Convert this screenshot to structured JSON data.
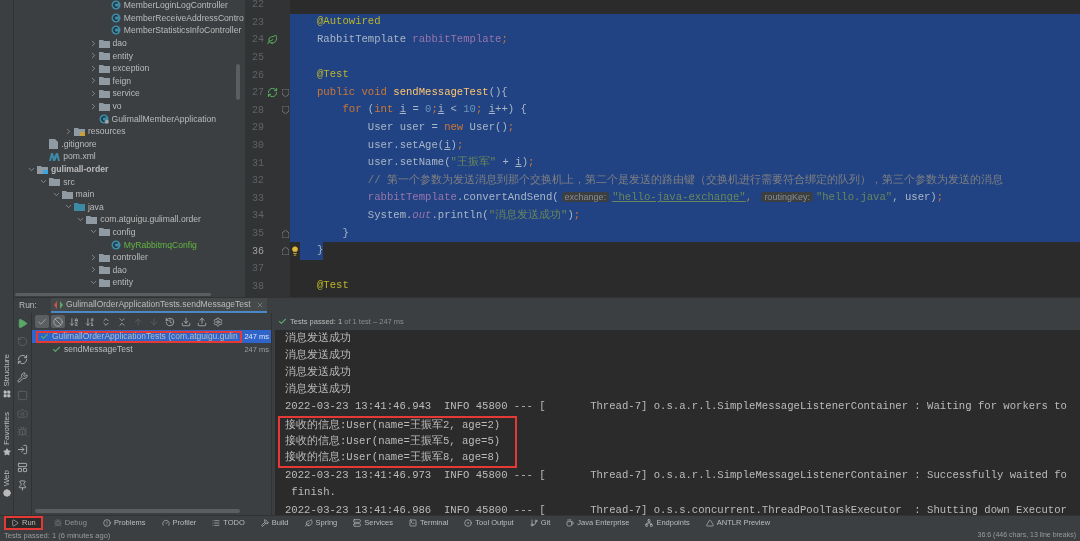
{
  "project_tree": [
    {
      "children": [
        {
          "children": [
            {
              "children": [
                {
                  "children": [
                    {
                      "children": [
                        {
                          "children": [
                            {
                              "label": "MemberLoginLogController",
                              "kind": "class"
                            },
                            {
                              "label": "MemberReceiveAddressContro",
                              "kind": "class"
                            },
                            {
                              "label": "MemberStatisticsInfoController",
                              "kind": "class"
                            }
                          ]
                        },
                        {
                          "label": "dao",
                          "kind": "folder",
                          "expanded": false
                        },
                        {
                          "label": "entity",
                          "kind": "folder",
                          "expanded": false
                        },
                        {
                          "label": "exception",
                          "kind": "folder",
                          "expanded": false
                        },
                        {
                          "label": "feign",
                          "kind": "folder",
                          "expanded": false
                        },
                        {
                          "label": "service",
                          "kind": "folder",
                          "expanded": false
                        },
                        {
                          "label": "vo",
                          "kind": "folder",
                          "expanded": false
                        },
                        {
                          "label": "GulimallMemberApplication",
                          "kind": "app"
                        }
                      ]
                    }
                  ]
                },
                {
                  "label": "resources",
                  "kind": "resources",
                  "expanded": false
                }
              ]
            }
          ]
        },
        {
          "label": ".gitignore",
          "kind": "file"
        },
        {
          "label": "pom.xml",
          "kind": "maven"
        }
      ]
    },
    {
      "label": "gulimall-order",
      "kind": "module",
      "expanded": true,
      "children": [
        {
          "label": "src",
          "kind": "folder",
          "expanded": true,
          "children": [
            {
              "label": "main",
              "kind": "folder",
              "expanded": true,
              "children": [
                {
                  "label": "java",
                  "kind": "source",
                  "expanded": true,
                  "children": [
                    {
                      "label": "com.atguigu.gulimall.order",
                      "kind": "folder",
                      "expanded": true,
                      "children": [
                        {
                          "label": "config",
                          "kind": "folder",
                          "expanded": true,
                          "children": [
                            {
                              "label": "MyRabbitmqConfig",
                              "kind": "new-class"
                            }
                          ]
                        },
                        {
                          "label": "controller",
                          "kind": "folder",
                          "expanded": false
                        },
                        {
                          "label": "dao",
                          "kind": "folder",
                          "expanded": false
                        },
                        {
                          "label": "entity",
                          "kind": "folder",
                          "expanded": true
                        }
                      ]
                    }
                  ]
                }
              ]
            }
          ]
        }
      ]
    }
  ],
  "editor": {
    "lines": [
      {
        "number": "22",
        "selected": false,
        "current": false
      },
      {
        "number": "23",
        "selected": true,
        "current": false,
        "tokens": [
          {
            "text": "@Autowired",
            "kind": "annotation"
          }
        ]
      },
      {
        "number": "24",
        "selected": true,
        "current": false,
        "icons": [
          {
            "kind": "bean"
          }
        ],
        "tokens": [
          {
            "text": "RabbitTemplate ",
            "kind": "plain"
          },
          {
            "text": "rabbitTemplate",
            "kind": "field"
          },
          {
            "text": ";",
            "kind": "keyword"
          }
        ]
      },
      {
        "number": "25",
        "selected": true,
        "current": false
      },
      {
        "number": "26",
        "selected": true,
        "current": false,
        "tokens": [
          {
            "text": "@Test",
            "kind": "annotation"
          }
        ]
      },
      {
        "number": "27",
        "selected": true,
        "current": false,
        "icons": [
          {
            "kind": "run"
          },
          {
            "kind": "fold-start"
          }
        ],
        "tokens": [
          {
            "text": "public void ",
            "kind": "keyword"
          },
          {
            "text": "sendMessageTest",
            "kind": "method"
          },
          {
            "text": "(){",
            "kind": "plain"
          }
        ]
      },
      {
        "number": "28",
        "selected": true,
        "current": false,
        "icons": [
          {
            "kind": "fold-start"
          }
        ],
        "tokens": [
          {
            "text": "    for",
            "kind": "keyword"
          },
          {
            "text": " (",
            "kind": "plain"
          },
          {
            "text": "int ",
            "kind": "keyword"
          },
          {
            "text": "i",
            "kind": "var"
          },
          {
            "text": " = ",
            "kind": "plain"
          },
          {
            "text": "0",
            "kind": "number"
          },
          {
            "text": ";",
            "kind": "keyword"
          },
          {
            "text": "i",
            "kind": "var"
          },
          {
            "text": " < ",
            "kind": "plain"
          },
          {
            "text": "10",
            "kind": "number"
          },
          {
            "text": "; ",
            "kind": "keyword"
          },
          {
            "text": "i",
            "kind": "var"
          },
          {
            "text": "++) {",
            "kind": "plain"
          }
        ]
      },
      {
        "number": "29",
        "selected": true,
        "current": false,
        "tokens": [
          {
            "text": "        User user = ",
            "kind": "plain"
          },
          {
            "text": "new",
            "kind": "keyword"
          },
          {
            "text": " User()",
            "kind": "plain"
          },
          {
            "text": ";",
            "kind": "keyword"
          }
        ]
      },
      {
        "number": "30",
        "selected": true,
        "current": false,
        "tokens": [
          {
            "text": "        user.setAge(",
            "kind": "plain"
          },
          {
            "text": "i",
            "kind": "var"
          },
          {
            "text": ")",
            "kind": "plain"
          },
          {
            "text": ";",
            "kind": "keyword"
          }
        ]
      },
      {
        "number": "31",
        "selected": true,
        "current": false,
        "tokens": [
          {
            "text": "        user.setName(",
            "kind": "plain"
          },
          {
            "text": "\"王振军\"",
            "kind": "string"
          },
          {
            "text": " + ",
            "kind": "plain"
          },
          {
            "text": "i",
            "kind": "var"
          },
          {
            "text": ")",
            "kind": "plain"
          },
          {
            "text": ";",
            "kind": "keyword"
          }
        ]
      },
      {
        "number": "32",
        "selected": true,
        "current": false,
        "tokens": [
          {
            "text": "        // 第一个参数为发送消息到那个交换机上，第二个是发送的路由键（交换机进行需要符合绑定的队列），第三个参数为发送的消息",
            "kind": "comment"
          }
        ]
      },
      {
        "number": "33",
        "selected": true,
        "current": false,
        "tokens": [
          {
            "text": "        rabbitTemplate",
            "kind": "field"
          },
          {
            "text": ".convertAndSend(",
            "kind": "plain"
          },
          {
            "text": "exchange:",
            "kind": "hint"
          },
          {
            "text": "\"hello-java-exchange\"",
            "kind": "link"
          },
          {
            "text": ", ",
            "kind": "keyword"
          },
          {
            "text": "routingKey:",
            "kind": "hint"
          },
          {
            "text": "\"hello.java\"",
            "kind": "string"
          },
          {
            "text": ", user)",
            "kind": "plain"
          },
          {
            "text": ";",
            "kind": "keyword"
          }
        ]
      },
      {
        "number": "34",
        "selected": true,
        "current": false,
        "tokens": [
          {
            "text": "        System.",
            "kind": "plain"
          },
          {
            "text": "out",
            "kind": "static"
          },
          {
            "text": ".println(",
            "kind": "plain"
          },
          {
            "text": "\"消息发送成功\"",
            "kind": "string"
          },
          {
            "text": ")",
            "kind": "plain"
          },
          {
            "text": ";",
            "kind": "keyword"
          }
        ]
      },
      {
        "number": "35",
        "selected": true,
        "current": false,
        "icons": [
          {
            "kind": "fold-end"
          }
        ],
        "tokens": [
          {
            "text": "    }",
            "kind": "plain"
          }
        ]
      },
      {
        "number": "36",
        "selected": true,
        "current": true,
        "icons": [
          {
            "kind": "fold-end"
          },
          {
            "kind": "bulb"
          }
        ],
        "tokens": [
          {
            "text": "}",
            "kind": "plain"
          }
        ]
      },
      {
        "number": "37",
        "selected": false,
        "current": false
      },
      {
        "number": "38",
        "selected": false,
        "current": false,
        "tokens": [
          {
            "text": "@Test",
            "kind": "annotation"
          }
        ]
      }
    ]
  },
  "side_labels": [
    {
      "label": "Structure",
      "kind": "structure"
    },
    {
      "label": "Favorites",
      "kind": "favorites"
    },
    {
      "label": "Web",
      "kind": "web"
    }
  ],
  "run_panel": {
    "label": "Run:",
    "tabs": [
      {
        "label": "GulimallOrderApplicationTests.sendMessageTest",
        "selected": true
      }
    ],
    "side_tools": [
      {
        "kind": "rerun",
        "disabled": false
      },
      {
        "kind": "rerun-failed",
        "disabled": true
      },
      {
        "kind": "toggle",
        "disabled": false
      },
      {
        "kind": "wrench",
        "disabled": false
      },
      {
        "kind": "stop",
        "disabled": true
      },
      {
        "kind": "camera",
        "disabled": true
      },
      {
        "kind": "bug",
        "disabled": true
      },
      {
        "kind": "exit",
        "disabled": false
      },
      {
        "kind": "layout",
        "disabled": false
      },
      {
        "kind": "pin",
        "disabled": false
      }
    ],
    "toolbar": [
      {
        "kind": "passed",
        "pressed": true
      },
      {
        "kind": "ignored",
        "pressed": true
      },
      {
        "kind": "sort-alpha",
        "pressed": false
      },
      {
        "kind": "sort-duration",
        "pressed": false
      },
      {
        "kind": "expand",
        "pressed": false
      },
      {
        "kind": "collapse",
        "pressed": false
      },
      {
        "kind": "up",
        "pressed": false
      },
      {
        "kind": "down",
        "pressed": false
      },
      {
        "kind": "history",
        "pressed": false
      },
      {
        "kind": "import",
        "pressed": false
      },
      {
        "kind": "export",
        "pressed": false
      },
      {
        "kind": "settings",
        "pressed": false
      }
    ],
    "summary": {
      "label": "Tests passed: 1",
      "detail": "of 1 test – 247 ms"
    },
    "tests": [
      {
        "label": "GulimallOrderApplicationTests (com.atguigu.gulin",
        "time": "247 ms",
        "selected": true,
        "highlighted": true,
        "children": [
          {
            "label": "sendMessageTest",
            "time": "247 ms",
            "selected": false,
            "highlighted": false
          }
        ]
      }
    ],
    "console": [
      {
        "text": "消息发送成功",
        "highlighted": false
      },
      {
        "text": "消息发送成功",
        "highlighted": false
      },
      {
        "text": "消息发送成功",
        "highlighted": false
      },
      {
        "text": "消息发送成功",
        "highlighted": false
      },
      {
        "text": "2022-03-23 13:41:46.943  INFO 45800 --- [       Thread-7] o.s.a.r.l.SimpleMessageListenerContainer : Waiting for workers to",
        "highlighted": false
      },
      {
        "text": "接收的信息:User(name=王振军2, age=2)",
        "highlighted": true
      },
      {
        "text": "接收的信息:User(name=王振军5, age=5)",
        "highlighted": true
      },
      {
        "text": "接收的信息:User(name=王振军8, age=8)",
        "highlighted": true
      },
      {
        "text": "2022-03-23 13:41:46.973  INFO 45800 --- [       Thread-7] o.s.a.r.l.SimpleMessageListenerContainer : Successfully waited fo",
        "highlighted": false
      },
      {
        "text": " finish.",
        "highlighted": false
      },
      {
        "text": "2022-03-23 13:41:46.986  INFO 45800 --- [       Thread-7] o.s.s.concurrent.ThreadPoolTaskExecutor  : Shutting down Executor",
        "highlighted": false
      }
    ]
  },
  "tool_windows": [
    {
      "label": "Run",
      "kind": "run",
      "selected": true,
      "disabled": false,
      "highlighted": true
    },
    {
      "label": "Debug",
      "kind": "debug",
      "selected": false,
      "disabled": true,
      "highlighted": false
    },
    {
      "label": "Problems",
      "kind": "problems",
      "selected": false,
      "disabled": false,
      "highlighted": false
    },
    {
      "label": "Profiler",
      "kind": "profiler",
      "selected": false,
      "disabled": false,
      "highlighted": false
    },
    {
      "label": "TODO",
      "kind": "todo",
      "selected": false,
      "disabled": false,
      "highlighted": false
    },
    {
      "label": "Build",
      "kind": "build",
      "selected": false,
      "disabled": false,
      "highlighted": false
    },
    {
      "label": "Spring",
      "kind": "spring",
      "selected": false,
      "disabled": false,
      "highlighted": false
    },
    {
      "label": "Services",
      "kind": "services",
      "selected": false,
      "disabled": false,
      "highlighted": false
    },
    {
      "label": "Terminal",
      "kind": "terminal",
      "selected": false,
      "disabled": false,
      "highlighted": false
    },
    {
      "label": "Tool Output",
      "kind": "output",
      "selected": false,
      "disabled": false,
      "highlighted": false
    },
    {
      "label": "Git",
      "kind": "git",
      "selected": false,
      "disabled": false,
      "highlighted": false
    },
    {
      "label": "Java Enterprise",
      "kind": "enterprise",
      "selected": false,
      "disabled": false,
      "highlighted": false
    },
    {
      "label": "Endpoints",
      "kind": "endpoints",
      "selected": false,
      "disabled": false,
      "highlighted": false
    },
    {
      "label": "ANTLR Preview",
      "kind": "antlr",
      "selected": false,
      "disabled": false,
      "highlighted": false
    }
  ],
  "status_bar": {
    "message": "Tests passed: 1 (6 minutes ago)",
    "position": "36:6 (446 chars, 13 line breaks)"
  }
}
